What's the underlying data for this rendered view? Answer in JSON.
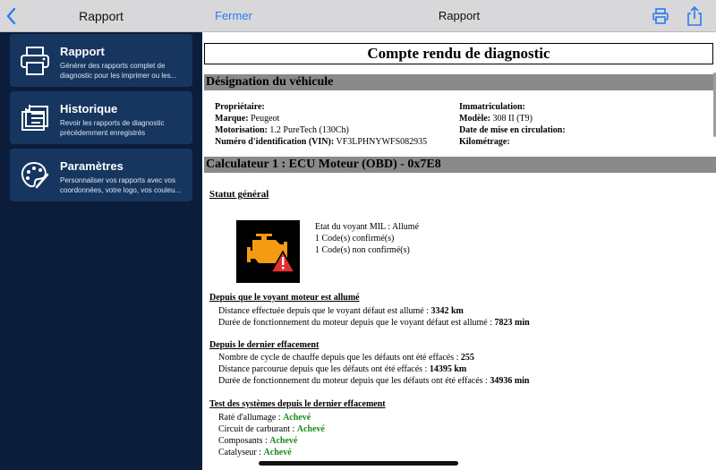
{
  "sidebar": {
    "title": "Rapport",
    "items": [
      {
        "label": "Rapport",
        "desc": "Générer des rapports complet de diagnostic pour les imprimer ou les...",
        "icon": "printer-icon"
      },
      {
        "label": "Historique",
        "desc": "Revoir les rapports de diagnostic précédemment enregistrés",
        "icon": "documents-icon"
      },
      {
        "label": "Paramètres",
        "desc": "Personnaliser vos rapports avec vos coordonnées, votre logo, vos couleu...",
        "icon": "palette-icon"
      }
    ]
  },
  "header": {
    "close_label": "Fermer",
    "title": "Rapport"
  },
  "report": {
    "title": "Compte rendu de diagnostic",
    "vehicle_section": "Désignation du véhicule",
    "vehicle": {
      "owner_label": "Propriétaire",
      "owner_value": "",
      "brand_label": "Marque",
      "brand_value": "Peugeot",
      "engine_label": "Motorisation",
      "engine_value": "1.2 PureTech (130Ch)",
      "vin_label": "Numéro d'identification (VIN)",
      "vin_value": "VF3LPHNYWFS082935",
      "plate_label": "Immatriculation",
      "plate_value": "",
      "model_label": "Modèle",
      "model_value": "308 II (T9)",
      "date_label": "Date de mise en circulation",
      "date_value": "",
      "mileage_label": "Kilométrage",
      "mileage_value": ""
    },
    "ecu_section": "Calculateur 1 : ECU Moteur (OBD) - 0x7E8",
    "status_heading": "Statut général",
    "mil_status": "Etat du voyant MIL : Allumé",
    "confirmed_codes": "1 Code(s) confirmé(s)",
    "unconfirmed_codes": "1 Code(s) non confirmé(s)",
    "since_mil_heading": "Depuis que le voyant moteur est allumé",
    "since_mil": {
      "distance_label": "Distance effectuée depuis que le voyant défaut est allumé : ",
      "distance_value": "3342 km",
      "duration_label": "Durée de fonctionnement du moteur depuis que le voyant défaut est allumé : ",
      "duration_value": "7823 min"
    },
    "since_clear_heading": "Depuis le dernier effacement",
    "since_clear": {
      "cycles_label": "Nombre de cycle de chauffe depuis que les défauts ont été effacés : ",
      "cycles_value": "255",
      "distance_label": "Distance parcourue depuis que les défauts ont été effacés : ",
      "distance_value": "14395 km",
      "duration_label": "Durée de fonctionnement du moteur depuis que les défauts ont été effacés : ",
      "duration_value": "34936 min"
    },
    "tests_heading": "Test des systèmes depuis le dernier effacement",
    "tests": [
      {
        "label": "Raté d'allumage : ",
        "value": "Achevé"
      },
      {
        "label": "Circuit de carburant : ",
        "value": "Achevé"
      },
      {
        "label": "Composants : ",
        "value": "Achevé"
      },
      {
        "label": "Catalyseur : ",
        "value": "Achevé"
      }
    ]
  },
  "colors": {
    "sidebar_bg": "#0b1d3a",
    "card_bg": "#16365f",
    "accent": "#2b7bf0",
    "ok": "#1a8a1a",
    "engine_warning": "#f39c12"
  }
}
